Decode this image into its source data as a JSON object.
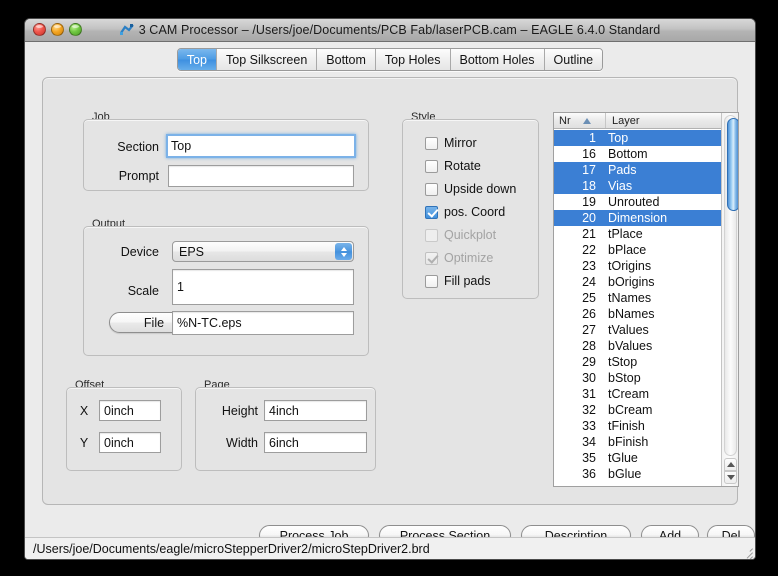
{
  "window": {
    "title": "3 CAM Processor – /Users/joe/Documents/PCB Fab/laserPCB.cam – EAGLE 6.4.0 Standard",
    "close_label": "",
    "minimize_label": "",
    "zoom_label": ""
  },
  "tabs": [
    {
      "label": "Top",
      "active": true
    },
    {
      "label": "Top Silkscreen",
      "active": false
    },
    {
      "label": "Bottom",
      "active": false
    },
    {
      "label": "Top Holes",
      "active": false
    },
    {
      "label": "Bottom Holes",
      "active": false
    },
    {
      "label": "Outline",
      "active": false
    }
  ],
  "job": {
    "group_label": "Job",
    "section_label": "Section",
    "section_value": "Top",
    "prompt_label": "Prompt",
    "prompt_value": ""
  },
  "output": {
    "group_label": "Output",
    "device_label": "Device",
    "device_value": "EPS",
    "scale_label": "Scale",
    "scale_value": "1",
    "file_button": "File",
    "file_value": "%N-TC.eps"
  },
  "offset": {
    "group_label": "Offset",
    "x_label": "X",
    "x_value": "0inch",
    "y_label": "Y",
    "y_value": "0inch"
  },
  "page": {
    "group_label": "Page",
    "height_label": "Height",
    "height_value": "4inch",
    "width_label": "Width",
    "width_value": "6inch"
  },
  "style": {
    "group_label": "Style",
    "options": [
      {
        "label": "Mirror",
        "checked": false,
        "disabled": false
      },
      {
        "label": "Rotate",
        "checked": false,
        "disabled": false
      },
      {
        "label": "Upside down",
        "checked": false,
        "disabled": false
      },
      {
        "label": "pos. Coord",
        "checked": true,
        "disabled": false
      },
      {
        "label": "Quickplot",
        "checked": false,
        "disabled": true
      },
      {
        "label": "Optimize",
        "checked": true,
        "disabled": true
      },
      {
        "label": "Fill pads",
        "checked": false,
        "disabled": false
      }
    ]
  },
  "layer_list": {
    "header": {
      "nr": "Nr",
      "layer": "Layer",
      "sort": "ascending"
    },
    "rows": [
      {
        "nr": "1",
        "name": "Top",
        "selected": true
      },
      {
        "nr": "16",
        "name": "Bottom",
        "selected": false
      },
      {
        "nr": "17",
        "name": "Pads",
        "selected": true
      },
      {
        "nr": "18",
        "name": "Vias",
        "selected": true
      },
      {
        "nr": "19",
        "name": "Unrouted",
        "selected": false
      },
      {
        "nr": "20",
        "name": "Dimension",
        "selected": true
      },
      {
        "nr": "21",
        "name": "tPlace",
        "selected": false
      },
      {
        "nr": "22",
        "name": "bPlace",
        "selected": false
      },
      {
        "nr": "23",
        "name": "tOrigins",
        "selected": false
      },
      {
        "nr": "24",
        "name": "bOrigins",
        "selected": false
      },
      {
        "nr": "25",
        "name": "tNames",
        "selected": false
      },
      {
        "nr": "26",
        "name": "bNames",
        "selected": false
      },
      {
        "nr": "27",
        "name": "tValues",
        "selected": false
      },
      {
        "nr": "28",
        "name": "bValues",
        "selected": false
      },
      {
        "nr": "29",
        "name": "tStop",
        "selected": false
      },
      {
        "nr": "30",
        "name": "bStop",
        "selected": false
      },
      {
        "nr": "31",
        "name": "tCream",
        "selected": false
      },
      {
        "nr": "32",
        "name": "bCream",
        "selected": false
      },
      {
        "nr": "33",
        "name": "tFinish",
        "selected": false
      },
      {
        "nr": "34",
        "name": "bFinish",
        "selected": false
      },
      {
        "nr": "35",
        "name": "tGlue",
        "selected": false
      },
      {
        "nr": "36",
        "name": "bGlue",
        "selected": false
      }
    ]
  },
  "buttons": {
    "process_job": "Process Job",
    "process_section": "Process Section",
    "description": "Description",
    "add": "Add",
    "del": "Del"
  },
  "status": {
    "path": "/Users/joe/Documents/eagle/microStepperDriver2/microStepDriver2.brd"
  },
  "colors": {
    "accent_blue": "#3b7fd4",
    "tab_active": "#4e9ce4",
    "panel_bg": "#e4e4e4",
    "window_bg": "#ebebeb"
  }
}
